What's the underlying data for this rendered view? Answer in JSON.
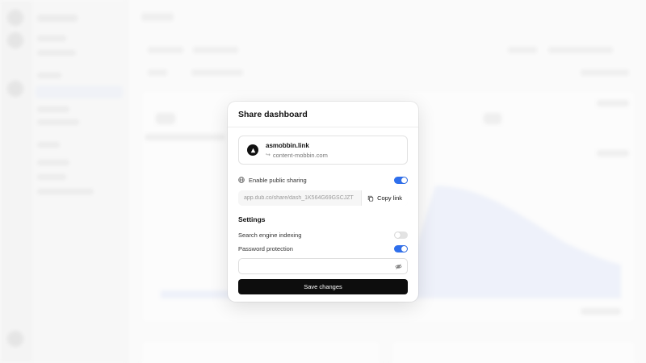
{
  "modal": {
    "title": "Share dashboard",
    "domain": {
      "name": "asmobbin.link",
      "target": "content-mobbin.com"
    },
    "public_sharing": {
      "label": "Enable public sharing",
      "enabled": true
    },
    "share_link": {
      "url": "app.dub.co/share/dash_1K564G69GSCJZT",
      "copy_label": "Copy link"
    },
    "settings": {
      "title": "Settings",
      "search_engine_indexing": {
        "label": "Search engine indexing",
        "enabled": false
      },
      "password_protection": {
        "label": "Password protection",
        "enabled": true
      }
    },
    "password": {
      "value": ""
    },
    "save_label": "Save changes"
  },
  "colors": {
    "accent": "#2f6fec",
    "button": "#0d0d0d",
    "toggle_off": "#e3e3e3"
  },
  "icons": [
    "logo-icon",
    "arrow-icon",
    "globe-icon",
    "copy-icon",
    "eye-off-icon"
  ]
}
